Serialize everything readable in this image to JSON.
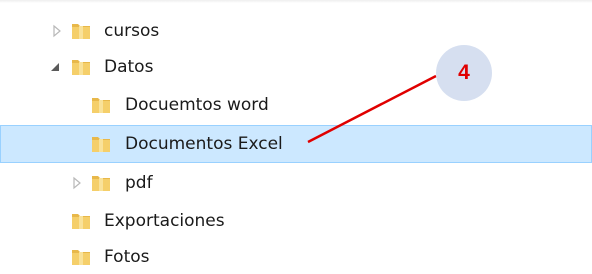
{
  "tree": {
    "items": [
      {
        "label": "cursos",
        "expander": "collapsed"
      },
      {
        "label": "Datos",
        "expander": "expanded"
      },
      {
        "label": "Docuemtos word",
        "expander": "none"
      },
      {
        "label": "Documentos Excel",
        "expander": "none",
        "selected": true
      },
      {
        "label": "pdf",
        "expander": "collapsed"
      },
      {
        "label": "Exportaciones",
        "expander": "none"
      },
      {
        "label": "Fotos",
        "expander": "none"
      }
    ]
  },
  "annotation": {
    "number": "4",
    "text_color": "#e00000",
    "circle_color": "#d6dff0",
    "arrow_color": "#e00000"
  },
  "colors": {
    "selection_background": "#cce8ff",
    "selection_border": "#99d1ff",
    "folder_yellow": "#f0c040"
  },
  "icons": {
    "folder": "folder-icon",
    "collapsed": "chevron-right-icon",
    "expanded": "triangle-down-icon"
  }
}
